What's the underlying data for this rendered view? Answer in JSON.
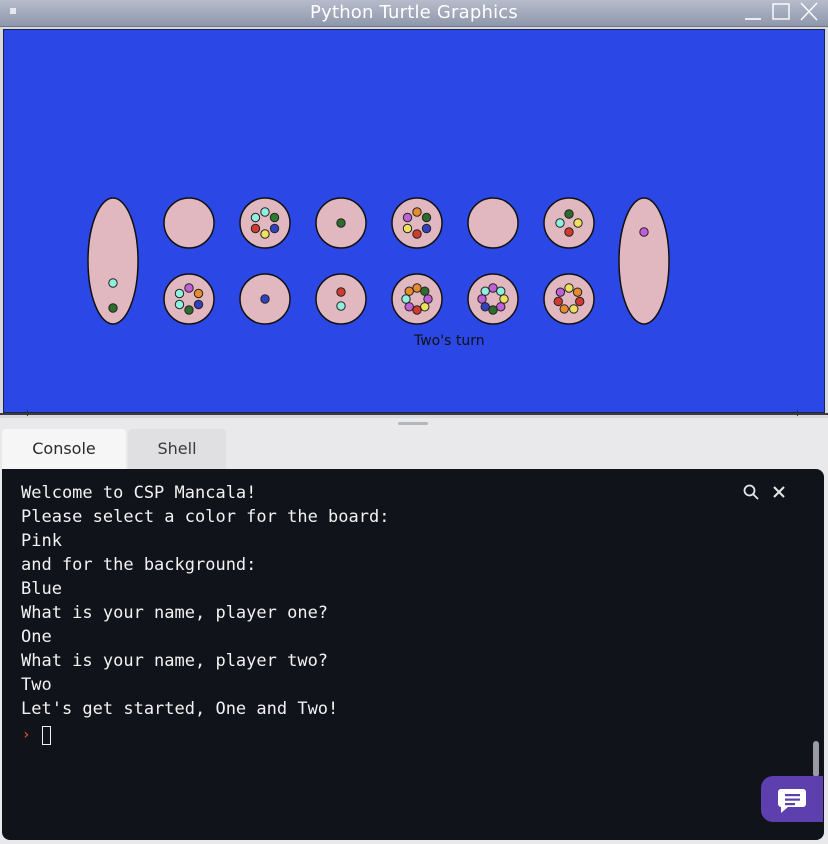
{
  "window": {
    "title": "Python Turtle Graphics"
  },
  "board": {
    "board_color": "#e2b8c0",
    "background_color": "#2b47e6",
    "turn_text": "Two's turn",
    "mancala_left": {
      "stones": [
        "#8ff0e0",
        "#2e6b2e"
      ]
    },
    "mancala_right": {
      "stones": [
        "#c060d8"
      ]
    },
    "top_row": [
      {
        "stones": []
      },
      {
        "stones": [
          "#8ff0e0",
          "#2e7a2e",
          "#3340c0",
          "#f0e060",
          "#d03a30",
          "#8ff0e0"
        ]
      },
      {
        "stones": [
          "#2e6b2e"
        ]
      },
      {
        "stones": [
          "#e88a2e",
          "#2e6b2e",
          "#3340c0",
          "#d03a30",
          "#f0e060",
          "#c060d8"
        ]
      },
      {
        "stones": []
      },
      {
        "stones": [
          "#2e6b2e",
          "#f0e060",
          "#d03a30",
          "#8ff0e0"
        ]
      }
    ],
    "bottom_row": [
      {
        "stones": [
          "#c060d8",
          "#e88a2e",
          "#3340c0",
          "#2e6b2e",
          "#8ff0e0",
          "#8ff0e0"
        ]
      },
      {
        "stones": [
          "#3340c0"
        ]
      },
      {
        "stones": [
          "#d03a30",
          "#8ff0e0"
        ]
      },
      {
        "stones": [
          "#e88a2e",
          "#2e6b2e",
          "#c060d8",
          "#f0e060",
          "#d03a30",
          "#c060d8",
          "#8ff0e0",
          "#e88a2e"
        ]
      },
      {
        "stones": [
          "#c060d8",
          "#8ff0e0",
          "#f0e060",
          "#c060d8",
          "#2e6b2e",
          "#3340c0",
          "#c060d8",
          "#8ff0e0"
        ]
      },
      {
        "stones": [
          "#f0e060",
          "#e88a2e",
          "#d03a30",
          "#f0e060",
          "#e88a2e",
          "#d03a30",
          "#c060d8"
        ]
      }
    ]
  },
  "tabs": [
    {
      "label": "Console",
      "active": true
    },
    {
      "label": "Shell",
      "active": false
    }
  ],
  "console": {
    "lines": [
      "Welcome to CSP Mancala!",
      "Please select a color for the board:",
      "Pink",
      "and for the background:",
      "Blue",
      "What is your name, player one?",
      "One",
      "What is your name, player two?",
      "Two",
      "Let's get started, One and Two!"
    ],
    "prompt_symbol": "›",
    "icons": {
      "search": "search-icon",
      "close": "close-icon",
      "chat": "chat-icon"
    }
  },
  "colors": {
    "console_bg": "#11131b",
    "chat_button": "#5d3fae",
    "prompt": "#e24a2b"
  }
}
